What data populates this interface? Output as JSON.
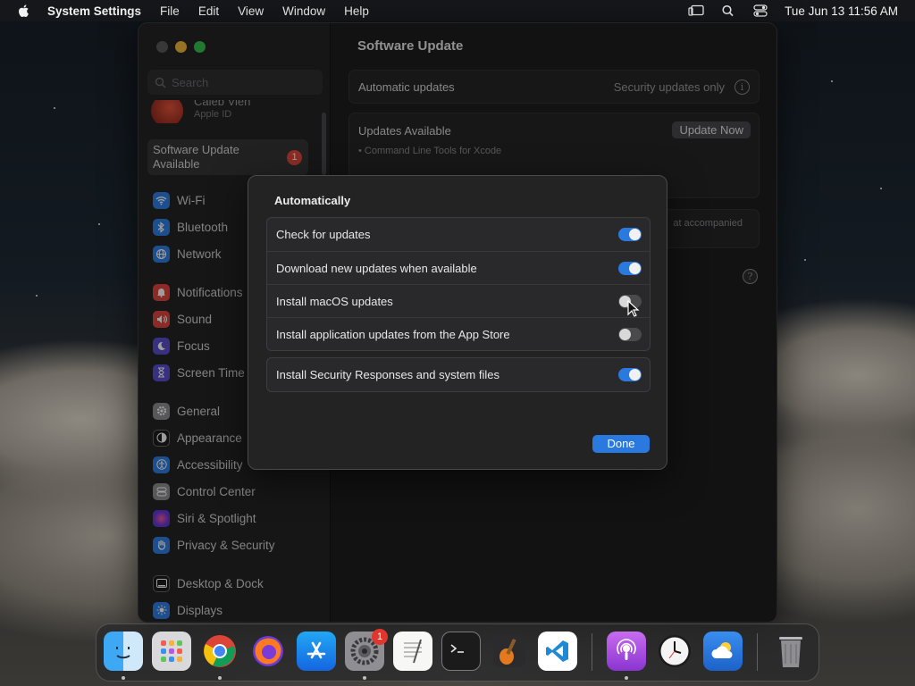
{
  "menubar": {
    "app_name": "System Settings",
    "menus": [
      "File",
      "Edit",
      "View",
      "Window",
      "Help"
    ],
    "clock": "Tue Jun 13  11:56 AM"
  },
  "sidebar": {
    "search_placeholder": "Search",
    "apple_id": {
      "name": "Caleb Vieh",
      "subtitle": "Apple ID"
    },
    "selected": {
      "label": "Software Update Available",
      "badge": "1"
    },
    "items": [
      {
        "label": "Wi-Fi",
        "icon": "wifi-icon",
        "color": "#2f7fe6"
      },
      {
        "label": "Bluetooth",
        "icon": "bluetooth-icon",
        "color": "#2f7fe6"
      },
      {
        "label": "Network",
        "icon": "globe-icon",
        "color": "#2f7fe6"
      },
      {
        "label": "Notifications",
        "icon": "bell-icon",
        "color": "#e2453c"
      },
      {
        "label": "Sound",
        "icon": "speaker-icon",
        "color": "#e2453c"
      },
      {
        "label": "Focus",
        "icon": "moon-icon",
        "color": "#5b4fd0"
      },
      {
        "label": "Screen Time",
        "icon": "hourglass-icon",
        "color": "#5b4fd0"
      },
      {
        "label": "General",
        "icon": "gear-icon",
        "color": "#8e8e93"
      },
      {
        "label": "Appearance",
        "icon": "appearance-icon",
        "color": "#1c1c1e"
      },
      {
        "label": "Accessibility",
        "icon": "accessibility-icon",
        "color": "#2f7fe6"
      },
      {
        "label": "Control Center",
        "icon": "control-center-icon",
        "color": "#8e8e93"
      },
      {
        "label": "Siri & Spotlight",
        "icon": "siri-icon",
        "color": "#b53fd0"
      },
      {
        "label": "Privacy & Security",
        "icon": "hand-icon",
        "color": "#2f7fe6"
      },
      {
        "label": "Desktop & Dock",
        "icon": "dock-icon",
        "color": "#1c1c1e"
      },
      {
        "label": "Displays",
        "icon": "sun-icon",
        "color": "#2f7fe6"
      }
    ]
  },
  "main": {
    "title": "Software Update",
    "automatic_updates": {
      "label": "Automatic updates",
      "value": "Security updates only"
    },
    "updates_available": {
      "label": "Updates Available",
      "button": "Update Now",
      "item": "• Command Line Tools for Xcode"
    },
    "partial_text": "at accompanied"
  },
  "sheet": {
    "title": "Automatically",
    "options": [
      {
        "label": "Check for updates",
        "on": true
      },
      {
        "label": "Download new updates when available",
        "on": true
      },
      {
        "label": "Install macOS updates",
        "on": false
      },
      {
        "label": "Install application updates from the App Store",
        "on": false
      }
    ],
    "security": {
      "label": "Install Security Responses and system files",
      "on": true
    },
    "done_label": "Done"
  },
  "dock": {
    "apps": [
      "Finder",
      "Launchpad",
      "Chrome",
      "Firefox",
      "App Store",
      "System Settings",
      "TextEdit",
      "Terminal",
      "GarageBand",
      "VS Code",
      "Podcasts",
      "Clock",
      "Weather",
      "Trash"
    ],
    "settings_badge": "1"
  }
}
